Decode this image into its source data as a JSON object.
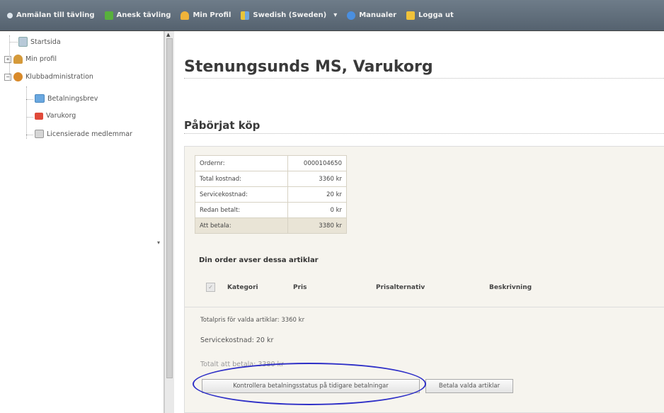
{
  "toolbar": {
    "items": [
      {
        "label": "Anmälan till tävling",
        "icon": "bullet-icon",
        "color": "#dfe7ee"
      },
      {
        "label": "Anesk tävling",
        "icon": "runner-icon",
        "color": "#58b03c"
      },
      {
        "label": "Min Profil",
        "icon": "person-icon",
        "color": "#f0b33a"
      },
      {
        "label": "Swedish (Sweden)",
        "icon": "flags-icon",
        "color": "#6fa6dd"
      },
      {
        "label": "Manualer",
        "icon": "help-icon",
        "color": "#4a8fe0"
      },
      {
        "label": "Logga ut",
        "icon": "door-icon",
        "color": "#f0c23a"
      }
    ],
    "dropdown_arrow": "▾"
  },
  "tree": {
    "items": [
      {
        "label": "Startsida",
        "icon": "page-icon"
      },
      {
        "label": "Min profil",
        "icon": "user-icon",
        "expander": "+"
      },
      {
        "label": "Klubbadministration",
        "icon": "club-icon",
        "expander": "−"
      },
      {
        "label": "Betalningsbrev",
        "icon": "letter-icon"
      },
      {
        "label": "Varukorg",
        "icon": "cart-icon"
      },
      {
        "label": "Licensierade medlemmar",
        "icon": "members-icon"
      }
    ]
  },
  "main": {
    "title": "Stenungsunds MS, Varukorg",
    "section_title": "Påbörjat köp",
    "summary": [
      {
        "key": "Ordernr:",
        "value": "0000104650"
      },
      {
        "key": "Total kostnad:",
        "value": "3360 kr"
      },
      {
        "key": "Servicekostnad:",
        "value": "20 kr"
      },
      {
        "key": "Redan betalt:",
        "value": "0 kr"
      },
      {
        "key": "Att betala:",
        "value": "3380 kr"
      }
    ],
    "order_heading": "Din order avser dessa artiklar",
    "columns": [
      "Kategori",
      "Pris",
      "Prisalternativ",
      "Beskrivning"
    ],
    "total_selected": "Totalpris för valda artiklar: 3360 kr",
    "service_cost": "Servicekostnad: 20 kr",
    "to_pay": "Totalt att betala: 3380 kr",
    "buttons": {
      "check_status": "Kontrollera betalningsstatus på tidigare betalningar",
      "pay_selected": "Betala valda artiklar"
    }
  }
}
